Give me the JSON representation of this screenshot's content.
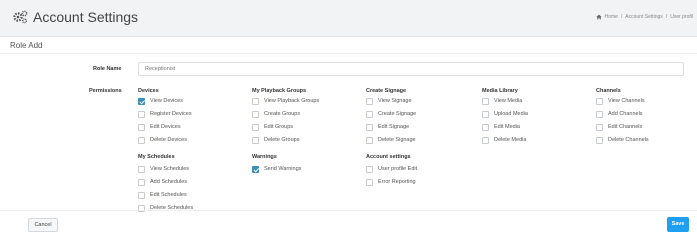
{
  "header": {
    "title": "Account Settings",
    "icon": "cogs-icon",
    "breadcrumb": {
      "home": "Home",
      "parent": "Account Settings",
      "current": "User profil"
    }
  },
  "panel": {
    "title": "Role Add"
  },
  "form": {
    "role_name_label": "Role Name",
    "role_name_value": "Receptionist",
    "permissions_label": "Permissions"
  },
  "groups": {
    "devices": {
      "title": "Devices",
      "items": [
        {
          "label": "View Devices",
          "checked": true
        },
        {
          "label": "Register Devices",
          "checked": false
        },
        {
          "label": "Edit Devices",
          "checked": false
        },
        {
          "label": "Delete Devices",
          "checked": false
        }
      ]
    },
    "playback": {
      "title": "My Playback Groups",
      "items": [
        {
          "label": "View Playback Groups",
          "checked": false
        },
        {
          "label": "Create Groups",
          "checked": false
        },
        {
          "label": "Edit Groups",
          "checked": false
        },
        {
          "label": "Delete Groups",
          "checked": false
        }
      ]
    },
    "signage": {
      "title": "Create Signage",
      "items": [
        {
          "label": "View Signage",
          "checked": false
        },
        {
          "label": "Create Signage",
          "checked": false
        },
        {
          "label": "Edit Signage",
          "checked": false
        },
        {
          "label": "Delete Signage",
          "checked": false
        }
      ]
    },
    "media": {
      "title": "Media Library",
      "items": [
        {
          "label": "View Media",
          "checked": false
        },
        {
          "label": "Upload Media",
          "checked": false
        },
        {
          "label": "Edit Media",
          "checked": false
        },
        {
          "label": "Delete Media",
          "checked": false
        }
      ]
    },
    "channels": {
      "title": "Channels",
      "items": [
        {
          "label": "View Channels",
          "checked": false
        },
        {
          "label": "Add Channels",
          "checked": false
        },
        {
          "label": "Edit Channels",
          "checked": false
        },
        {
          "label": "Delete Channels",
          "checked": false
        }
      ]
    },
    "schedules": {
      "title": "My Schedules",
      "items": [
        {
          "label": "View Schedules",
          "checked": false
        },
        {
          "label": "Add Schedules",
          "checked": false
        },
        {
          "label": "Edit Schedules",
          "checked": false
        },
        {
          "label": "Delete Schedules",
          "checked": false
        }
      ]
    },
    "warnings": {
      "title": "Warnings",
      "items": [
        {
          "label": "Send Warnings",
          "checked": true
        }
      ]
    },
    "account": {
      "title": "Account settings",
      "items": [
        {
          "label": "User profile Edit",
          "checked": false
        },
        {
          "label": "Error Reporting",
          "checked": false
        }
      ]
    }
  },
  "buttons": {
    "cancel": "Cancel",
    "save": "Save"
  },
  "colors": {
    "primary": "#1e9ff2",
    "checkbox_checked": "#3c8dbc"
  }
}
